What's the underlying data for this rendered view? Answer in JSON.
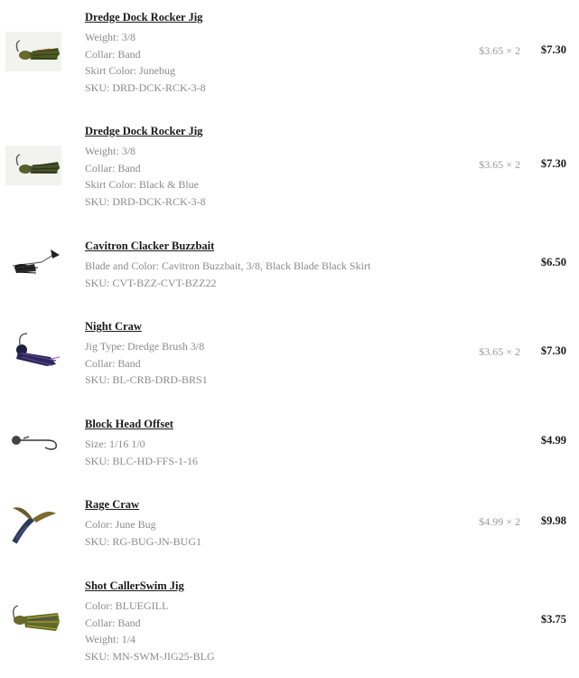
{
  "items": [
    {
      "name": "Dredge Dock Rocker Jig",
      "attributes": [
        "Weight: 3/8",
        "Collar: Band",
        "Skirt Color: Junebug",
        "SKU: DRD-DCK-RCK-3-8"
      ],
      "unit_price": "$3.65 × 2",
      "total": "$7.30",
      "image": "jig-junebug-image"
    },
    {
      "name": "Dredge Dock Rocker Jig",
      "attributes": [
        "Weight: 3/8",
        "Collar: Band",
        "Skirt Color: Black & Blue",
        "SKU: DRD-DCK-RCK-3-8"
      ],
      "unit_price": "$3.65 × 2",
      "total": "$7.30",
      "image": "jig-black-blue-image"
    },
    {
      "name": "Cavitron Clacker Buzzbait",
      "attributes": [
        "Blade and Color: Cavitron Buzzbait, 3/8, Black Blade Black Skirt",
        "SKU: CVT-BZZ-CVT-BZZ22"
      ],
      "unit_price": "",
      "total": "$6.50",
      "image": "buzzbait-image"
    },
    {
      "name": "Night Craw",
      "attributes": [
        "Jig Type: Dredge Brush 3/8",
        "Collar: Band",
        "SKU: BL-CRB-DRD-BRS1"
      ],
      "unit_price": "$3.65 × 2",
      "total": "$7.30",
      "image": "night-craw-jig-image"
    },
    {
      "name": "Block Head Offset",
      "attributes": [
        "Size: 1/16 1/0",
        "SKU: BLC-HD-FFS-1-16"
      ],
      "unit_price": "",
      "total": "$4.99",
      "image": "offset-hook-image"
    },
    {
      "name": "Rage Craw",
      "attributes": [
        "Color: June Bug",
        "SKU: RG-BUG-JN-BUG1"
      ],
      "unit_price": "$4.99 × 2",
      "total": "$9.98",
      "image": "rage-craw-image"
    },
    {
      "name": "Shot CallerSwim Jig",
      "attributes": [
        "Color: BLUEGILL",
        "Collar: Band",
        "Weight: 1/4",
        "SKU: MN-SWM-JIG25-BLG"
      ],
      "unit_price": "",
      "total": "$3.75",
      "image": "swim-jig-image"
    }
  ]
}
